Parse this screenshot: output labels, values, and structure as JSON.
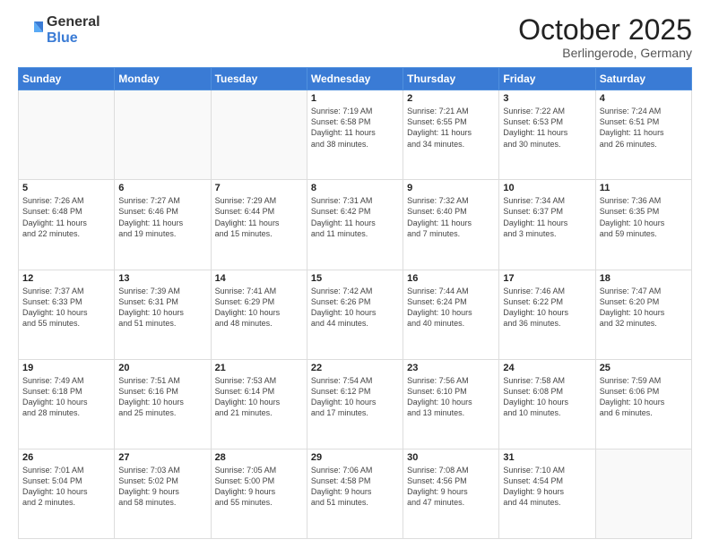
{
  "header": {
    "logo_general": "General",
    "logo_blue": "Blue",
    "month_title": "October 2025",
    "location": "Berlingerode, Germany"
  },
  "weekdays": [
    "Sunday",
    "Monday",
    "Tuesday",
    "Wednesday",
    "Thursday",
    "Friday",
    "Saturday"
  ],
  "weeks": [
    [
      {
        "day": "",
        "info": ""
      },
      {
        "day": "",
        "info": ""
      },
      {
        "day": "",
        "info": ""
      },
      {
        "day": "1",
        "info": "Sunrise: 7:19 AM\nSunset: 6:58 PM\nDaylight: 11 hours\nand 38 minutes."
      },
      {
        "day": "2",
        "info": "Sunrise: 7:21 AM\nSunset: 6:55 PM\nDaylight: 11 hours\nand 34 minutes."
      },
      {
        "day": "3",
        "info": "Sunrise: 7:22 AM\nSunset: 6:53 PM\nDaylight: 11 hours\nand 30 minutes."
      },
      {
        "day": "4",
        "info": "Sunrise: 7:24 AM\nSunset: 6:51 PM\nDaylight: 11 hours\nand 26 minutes."
      }
    ],
    [
      {
        "day": "5",
        "info": "Sunrise: 7:26 AM\nSunset: 6:48 PM\nDaylight: 11 hours\nand 22 minutes."
      },
      {
        "day": "6",
        "info": "Sunrise: 7:27 AM\nSunset: 6:46 PM\nDaylight: 11 hours\nand 19 minutes."
      },
      {
        "day": "7",
        "info": "Sunrise: 7:29 AM\nSunset: 6:44 PM\nDaylight: 11 hours\nand 15 minutes."
      },
      {
        "day": "8",
        "info": "Sunrise: 7:31 AM\nSunset: 6:42 PM\nDaylight: 11 hours\nand 11 minutes."
      },
      {
        "day": "9",
        "info": "Sunrise: 7:32 AM\nSunset: 6:40 PM\nDaylight: 11 hours\nand 7 minutes."
      },
      {
        "day": "10",
        "info": "Sunrise: 7:34 AM\nSunset: 6:37 PM\nDaylight: 11 hours\nand 3 minutes."
      },
      {
        "day": "11",
        "info": "Sunrise: 7:36 AM\nSunset: 6:35 PM\nDaylight: 10 hours\nand 59 minutes."
      }
    ],
    [
      {
        "day": "12",
        "info": "Sunrise: 7:37 AM\nSunset: 6:33 PM\nDaylight: 10 hours\nand 55 minutes."
      },
      {
        "day": "13",
        "info": "Sunrise: 7:39 AM\nSunset: 6:31 PM\nDaylight: 10 hours\nand 51 minutes."
      },
      {
        "day": "14",
        "info": "Sunrise: 7:41 AM\nSunset: 6:29 PM\nDaylight: 10 hours\nand 48 minutes."
      },
      {
        "day": "15",
        "info": "Sunrise: 7:42 AM\nSunset: 6:26 PM\nDaylight: 10 hours\nand 44 minutes."
      },
      {
        "day": "16",
        "info": "Sunrise: 7:44 AM\nSunset: 6:24 PM\nDaylight: 10 hours\nand 40 minutes."
      },
      {
        "day": "17",
        "info": "Sunrise: 7:46 AM\nSunset: 6:22 PM\nDaylight: 10 hours\nand 36 minutes."
      },
      {
        "day": "18",
        "info": "Sunrise: 7:47 AM\nSunset: 6:20 PM\nDaylight: 10 hours\nand 32 minutes."
      }
    ],
    [
      {
        "day": "19",
        "info": "Sunrise: 7:49 AM\nSunset: 6:18 PM\nDaylight: 10 hours\nand 28 minutes."
      },
      {
        "day": "20",
        "info": "Sunrise: 7:51 AM\nSunset: 6:16 PM\nDaylight: 10 hours\nand 25 minutes."
      },
      {
        "day": "21",
        "info": "Sunrise: 7:53 AM\nSunset: 6:14 PM\nDaylight: 10 hours\nand 21 minutes."
      },
      {
        "day": "22",
        "info": "Sunrise: 7:54 AM\nSunset: 6:12 PM\nDaylight: 10 hours\nand 17 minutes."
      },
      {
        "day": "23",
        "info": "Sunrise: 7:56 AM\nSunset: 6:10 PM\nDaylight: 10 hours\nand 13 minutes."
      },
      {
        "day": "24",
        "info": "Sunrise: 7:58 AM\nSunset: 6:08 PM\nDaylight: 10 hours\nand 10 minutes."
      },
      {
        "day": "25",
        "info": "Sunrise: 7:59 AM\nSunset: 6:06 PM\nDaylight: 10 hours\nand 6 minutes."
      }
    ],
    [
      {
        "day": "26",
        "info": "Sunrise: 7:01 AM\nSunset: 5:04 PM\nDaylight: 10 hours\nand 2 minutes."
      },
      {
        "day": "27",
        "info": "Sunrise: 7:03 AM\nSunset: 5:02 PM\nDaylight: 9 hours\nand 58 minutes."
      },
      {
        "day": "28",
        "info": "Sunrise: 7:05 AM\nSunset: 5:00 PM\nDaylight: 9 hours\nand 55 minutes."
      },
      {
        "day": "29",
        "info": "Sunrise: 7:06 AM\nSunset: 4:58 PM\nDaylight: 9 hours\nand 51 minutes."
      },
      {
        "day": "30",
        "info": "Sunrise: 7:08 AM\nSunset: 4:56 PM\nDaylight: 9 hours\nand 47 minutes."
      },
      {
        "day": "31",
        "info": "Sunrise: 7:10 AM\nSunset: 4:54 PM\nDaylight: 9 hours\nand 44 minutes."
      },
      {
        "day": "",
        "info": ""
      }
    ]
  ]
}
